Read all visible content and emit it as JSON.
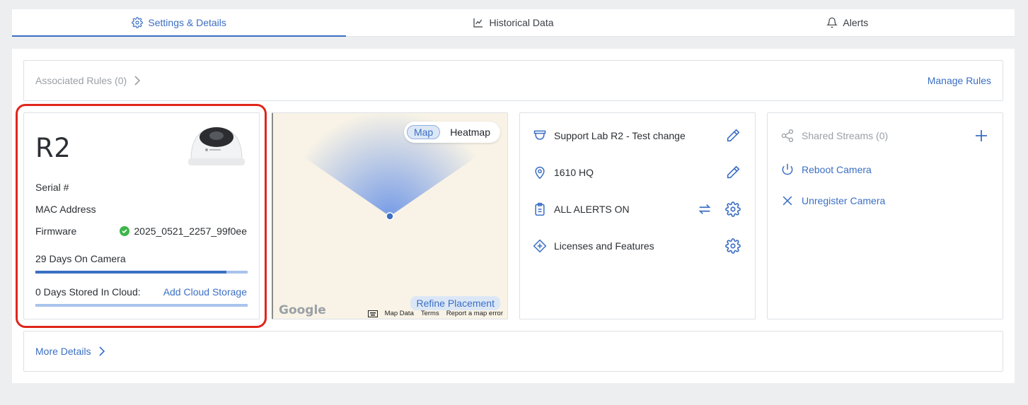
{
  "tabs": [
    {
      "label": "Settings & Details",
      "icon": "gear-icon",
      "active": true
    },
    {
      "label": "Historical Data",
      "icon": "chart-line-icon",
      "active": false
    },
    {
      "label": "Alerts",
      "icon": "bell-icon",
      "active": false
    }
  ],
  "rules": {
    "label": "Associated Rules (0)",
    "manage": "Manage Rules"
  },
  "camera": {
    "name": "R2",
    "serial_label": "Serial #",
    "mac_label": "MAC Address",
    "firmware_label": "Firmware",
    "firmware_value": "2025_0521_2257_99f0ee",
    "days_on_camera": "29 Days On Camera",
    "days_on_camera_fraction": 0.9,
    "days_in_cloud": "0 Days Stored In Cloud:",
    "add_cloud": "Add Cloud Storage"
  },
  "map": {
    "toggle": [
      "Map",
      "Heatmap"
    ],
    "refine": "Refine Placement",
    "google": "Google",
    "footer": [
      "Map Data",
      "Terms",
      "Report a map error"
    ]
  },
  "info": [
    {
      "icon": "camera-dome-icon",
      "text": "Support Lab R2 - Test change",
      "actions": [
        "pencil-icon"
      ]
    },
    {
      "icon": "map-pin-icon",
      "text": "1610 HQ",
      "actions": [
        "pencil-icon"
      ]
    },
    {
      "icon": "clipboard-icon",
      "text": "ALL ALERTS ON",
      "actions": [
        "swap-arrows-icon",
        "gear-icon"
      ]
    },
    {
      "icon": "diamond-plus-icon",
      "text": "Licenses and Features",
      "actions": [
        "gear-icon"
      ]
    }
  ],
  "streams": {
    "shared": "Shared Streams (0)",
    "reboot": "Reboot Camera",
    "unregister": "Unregister Camera"
  },
  "more": "More Details",
  "colors": {
    "accent": "#3b6fc4",
    "highlight": "#e0261b",
    "success": "#3cb54a"
  }
}
